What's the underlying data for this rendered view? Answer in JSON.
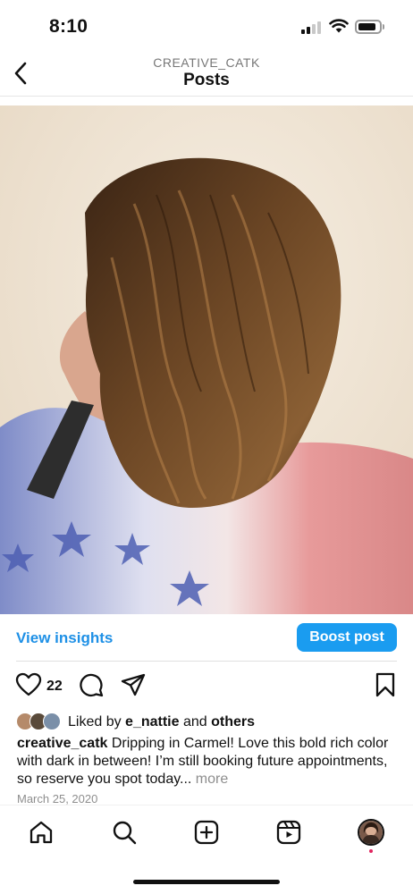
{
  "status_bar": {
    "time": "8:10"
  },
  "header": {
    "username": "CREATIVE_CATK",
    "title": "Posts"
  },
  "insights": {
    "view_label": "View insights",
    "boost_label": "Boost post"
  },
  "actions": {
    "like_count": "22"
  },
  "likes": {
    "prefix": "Liked by ",
    "user": "e_nattie",
    "middle": " and ",
    "others": "others"
  },
  "caption": {
    "username": "creative_catk",
    "text": " Dripping in Carmel! Love this bold rich color with dark in between! I’m still booking future appointments, so reserve you spot today...",
    "more": " more"
  },
  "post_date": "March 25, 2020",
  "colors": {
    "accent": "#1a9cf0",
    "link": "#1e90e6",
    "notification": "#e0245e"
  },
  "icons": {
    "back": "chevron-left-icon",
    "like": "heart-icon",
    "comment": "comment-icon",
    "share": "send-icon",
    "save": "bookmark-icon",
    "nav": [
      "home-icon",
      "search-icon",
      "add-icon",
      "reels-icon",
      "profile-avatar"
    ]
  }
}
